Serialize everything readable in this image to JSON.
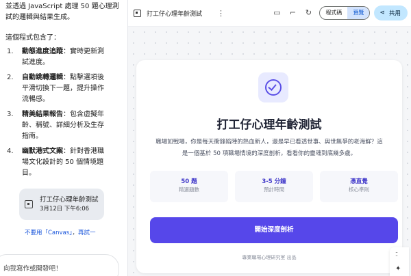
{
  "chat": {
    "intro": "並透過 JavaScript 處理 50 題心理測試的邏輯與結果生成。",
    "lead": "這個程式包含了：",
    "items": [
      {
        "num": "1.",
        "title": "動態進度追蹤",
        "text": "：實時更新測試進度。"
      },
      {
        "num": "2.",
        "title": "自動跳轉邏輯",
        "text": "：點擊選項後平滑切換下一題，提升操作流暢感。"
      },
      {
        "num": "3.",
        "title": "精美結果報告",
        "text": "：包含虛擬年齡、稱號、詳細分析及生存指南。"
      },
      {
        "num": "4.",
        "title": "幽默港式文案",
        "text": "：針對香港職場文化設計的 50 個情境題目。"
      }
    ],
    "chip": {
      "title": "打工仔心理年齡測試",
      "timestamp": "3月12日 下午6:06",
      "icon": "document-icon"
    },
    "retry": {
      "undo": "不要用「Canvas」",
      "sep": "，",
      "again": "再試一"
    },
    "composer_placeholder": "向我寫作或開發吧！"
  },
  "canvas": {
    "title": "打工仔心理年齡測試",
    "more_icon": "more-vert-icon",
    "icons": [
      "desktop-icon",
      "code-icon",
      "refresh-icon"
    ],
    "toggle": {
      "code": "程式碼",
      "preview": "預覽"
    },
    "share": "共用",
    "card": {
      "badge_icon": "check-circle-icon",
      "heading": "打工仔心理年齡測試",
      "description": "職場如戰場，你是每天衝鋒陷陣的熱血新人，還是早已看透世事、與世無爭的老海鮮？這是一個基於 50 項職場情境的深度剖析，看看你的靈魂到底幾多歲。",
      "stats": [
        {
          "value": "50 題",
          "label": "精選題數"
        },
        {
          "value": "3-5 分鐘",
          "label": "預計時間"
        },
        {
          "value": "憑直覺",
          "label": "核心準則"
        }
      ],
      "start_button": "開始深度剖析",
      "footer": "專業職場心理研究室 出品"
    }
  },
  "colors": {
    "accent": "#5647ea",
    "preview_active": "#d3e3fd",
    "share_bg": "#c2e7ff"
  }
}
